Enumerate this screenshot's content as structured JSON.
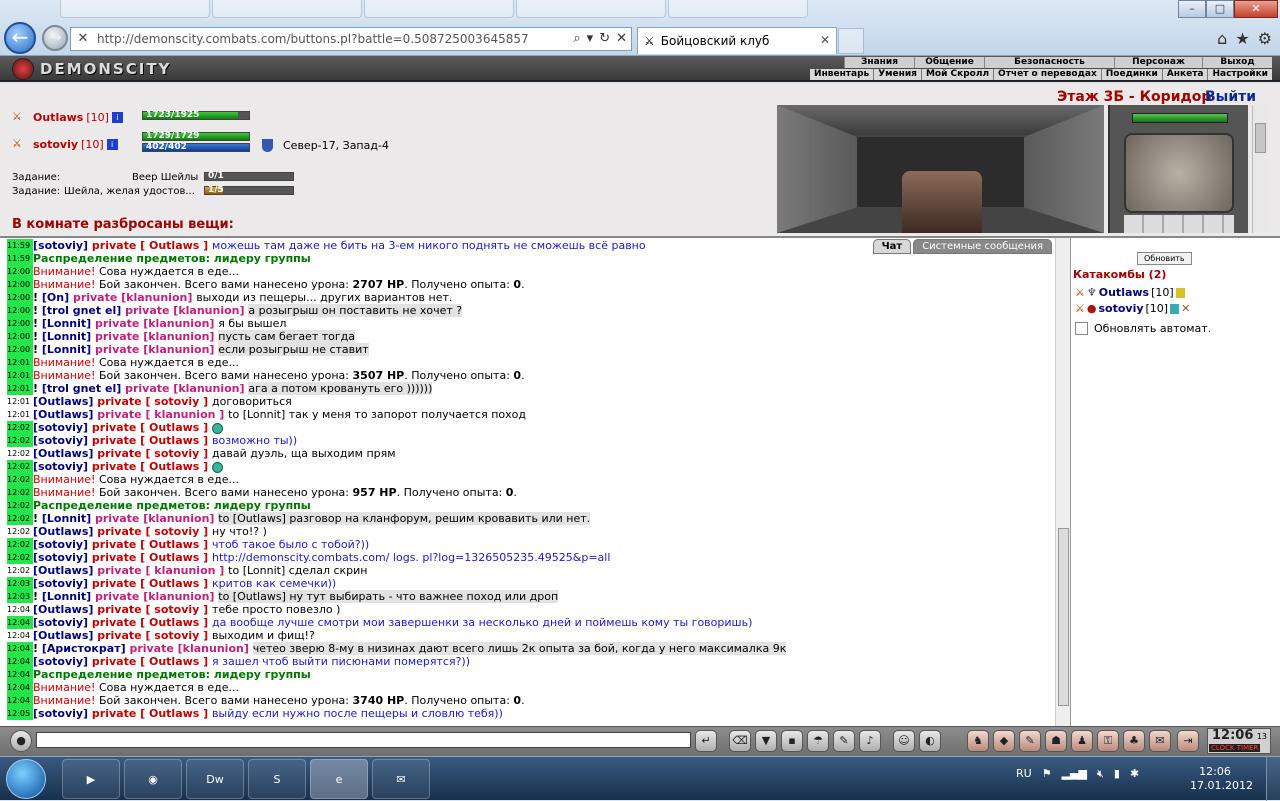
{
  "browser": {
    "url": "http://demonscity.combats.com/buttons.pl?battle=0.508725003645857",
    "tab_title": "Бойцовский клуб",
    "win_min": "–",
    "win_max": "□",
    "win_close": "✕",
    "back": "←",
    "fwd": "→"
  },
  "game": {
    "logo": "DEMONSCITY",
    "menu_top": [
      "Знания",
      "Общение",
      "Безопасность",
      "Персонаж",
      "Выход"
    ],
    "menu_bottom": [
      "Инвентарь",
      "Умения",
      "Мой Скролл",
      "Отчет о переводах",
      "Поединки",
      "Анкета",
      "Настройки"
    ]
  },
  "status": {
    "location": "Этаж 3Б - Коридор",
    "exit": "Выйти",
    "chars": [
      {
        "name": "Outlaws",
        "level": "[10]",
        "hp": "1723/1925",
        "hp_frac": 0.895
      },
      {
        "name": "sotoviy",
        "level": "[10]",
        "hp": "1729/1729",
        "hp_frac": 1.0,
        "mana": "402/402",
        "mana_frac": 1.0
      }
    ],
    "coord": "Север-17, Запад-4",
    "tasks": [
      {
        "label": "Задание:",
        "name": "Веер Шейлы",
        "progress": "0/1",
        "frac": 0.0
      },
      {
        "label": "Задание:",
        "name": "Шейла, желая удостов...",
        "progress": "1/5",
        "frac": 0.2
      }
    ],
    "items_header": "В комнате разбросаны вещи:"
  },
  "chat": {
    "tab_chat": "Чат",
    "tab_system": "Системные сообщения",
    "messages": [
      {
        "ts": "11:59",
        "hl": true,
        "parts": [
          [
            "nick",
            "[sotoviy]"
          ],
          [
            "priv",
            " private [ Outlaws ] "
          ],
          [
            "blue",
            "можешь там даже не бить на 3-ем никого поднять не сможешь всё равно"
          ]
        ]
      },
      {
        "ts": "11:59",
        "hl": true,
        "parts": [
          [
            "dist",
            "Распределение предметов: лидеру группы"
          ]
        ]
      },
      {
        "ts": "12:00",
        "hl": true,
        "parts": [
          [
            "warn",
            "Внимание! "
          ],
          [
            "tx",
            "Сова нуждается в еде..."
          ]
        ]
      },
      {
        "ts": "12:00",
        "hl": true,
        "parts": [
          [
            "warn",
            "Внимание! "
          ],
          [
            "tx",
            "Бой закончен. Всего вами нанесено урона: "
          ],
          [
            "ex",
            "2707 HP"
          ],
          [
            "tx",
            ". Получено опыта: "
          ],
          [
            "ex",
            "0"
          ],
          [
            "tx",
            "."
          ]
        ]
      },
      {
        "ts": "12:00",
        "hl": true,
        "parts": [
          [
            "ex",
            "! "
          ],
          [
            "nick",
            "[On]"
          ],
          [
            "priv2",
            " private [klanunion] "
          ],
          [
            "tx",
            "выходи из пещеры... других вариантов нет."
          ]
        ]
      },
      {
        "ts": "12:00",
        "hl": true,
        "parts": [
          [
            "ex",
            "! "
          ],
          [
            "nick",
            "[trol gnet el]"
          ],
          [
            "priv2",
            " private [klanunion] "
          ],
          [
            "hl",
            "а розыгрыш он поставить не хочет ?"
          ]
        ]
      },
      {
        "ts": "12:00",
        "hl": true,
        "parts": [
          [
            "ex",
            "! "
          ],
          [
            "nick",
            "[Lonnit]"
          ],
          [
            "priv2",
            " private [klanunion] "
          ],
          [
            "tx",
            "я бы вышел"
          ]
        ]
      },
      {
        "ts": "12:00",
        "hl": true,
        "parts": [
          [
            "ex",
            "! "
          ],
          [
            "nick",
            "[Lonnit]"
          ],
          [
            "priv2",
            " private [klanunion] "
          ],
          [
            "hl",
            "пусть сам бегает тогда"
          ]
        ]
      },
      {
        "ts": "12:00",
        "hl": true,
        "parts": [
          [
            "ex",
            "! "
          ],
          [
            "nick",
            "[Lonnit]"
          ],
          [
            "priv2",
            " private [klanunion] "
          ],
          [
            "hl",
            "если розыгрыш не ставит"
          ]
        ]
      },
      {
        "ts": "12:01",
        "hl": true,
        "parts": [
          [
            "warn",
            "Внимание! "
          ],
          [
            "tx",
            "Сова нуждается в еде..."
          ]
        ]
      },
      {
        "ts": "12:01",
        "hl": true,
        "parts": [
          [
            "warn",
            "Внимание! "
          ],
          [
            "tx",
            "Бой закончен. Всего вами нанесено урона: "
          ],
          [
            "ex",
            "3507 HP"
          ],
          [
            "tx",
            ". Получено опыта: "
          ],
          [
            "ex",
            "0"
          ],
          [
            "tx",
            "."
          ]
        ]
      },
      {
        "ts": "12:01",
        "hl": true,
        "parts": [
          [
            "ex",
            "! "
          ],
          [
            "nick",
            "[trol gnet el]"
          ],
          [
            "priv2",
            " private [klanunion] "
          ],
          [
            "hl",
            "ага а потом кровануть его ))))))"
          ]
        ]
      },
      {
        "ts": "12:01",
        "hl": false,
        "parts": [
          [
            "nick",
            "[Outlaws]"
          ],
          [
            "priv",
            " private [ sotoviy ] "
          ],
          [
            "tx",
            "договориться"
          ]
        ]
      },
      {
        "ts": "12:01",
        "hl": false,
        "parts": [
          [
            "nick",
            "[Outlaws]"
          ],
          [
            "priv2",
            " private [ klanunion ] "
          ],
          [
            "tx",
            "to [Lonnit] так у меня то запорот получается поход"
          ]
        ]
      },
      {
        "ts": "12:02",
        "hl": true,
        "smile": true,
        "parts": [
          [
            "nick",
            "[sotoviy]"
          ],
          [
            "priv",
            " private [ Outlaws ] "
          ]
        ]
      },
      {
        "ts": "12:02",
        "hl": true,
        "parts": [
          [
            "nick",
            "[sotoviy]"
          ],
          [
            "priv",
            " private [ Outlaws ] "
          ],
          [
            "blue",
            "возможно ты))"
          ]
        ]
      },
      {
        "ts": "12:02",
        "hl": false,
        "parts": [
          [
            "nick",
            "[Outlaws]"
          ],
          [
            "priv",
            " private [ sotoviy ] "
          ],
          [
            "tx",
            "давай дуэль, ща выходим прям"
          ]
        ]
      },
      {
        "ts": "12:02",
        "hl": true,
        "smile": true,
        "parts": [
          [
            "nick",
            "[sotoviy]"
          ],
          [
            "priv",
            " private [ Outlaws ] "
          ]
        ]
      },
      {
        "ts": "12:02",
        "hl": true,
        "parts": [
          [
            "warn",
            "Внимание! "
          ],
          [
            "tx",
            "Сова нуждается в еде..."
          ]
        ]
      },
      {
        "ts": "12:02",
        "hl": true,
        "parts": [
          [
            "warn",
            "Внимание! "
          ],
          [
            "tx",
            "Бой закончен. Всего вами нанесено урона: "
          ],
          [
            "ex",
            "957 HP"
          ],
          [
            "tx",
            ". Получено опыта: "
          ],
          [
            "ex",
            "0"
          ],
          [
            "tx",
            "."
          ]
        ]
      },
      {
        "ts": "12:02",
        "hl": true,
        "parts": [
          [
            "dist",
            "Распределение предметов: лидеру группы"
          ]
        ]
      },
      {
        "ts": "12:02",
        "hl": true,
        "parts": [
          [
            "ex",
            "! "
          ],
          [
            "nick",
            "[Lonnit]"
          ],
          [
            "priv2",
            " private [klanunion] "
          ],
          [
            "hl",
            "to [Outlaws] разговор на кланфорум, решим кровавить или нет."
          ]
        ]
      },
      {
        "ts": "12:02",
        "hl": false,
        "parts": [
          [
            "nick",
            "[Outlaws]"
          ],
          [
            "priv",
            " private [ sotoviy ] "
          ],
          [
            "tx",
            "ну что!? )"
          ]
        ]
      },
      {
        "ts": "12:02",
        "hl": true,
        "parts": [
          [
            "nick",
            "[sotoviy]"
          ],
          [
            "priv",
            " private [ Outlaws ] "
          ],
          [
            "blue",
            "чтоб такое было с тобой?))"
          ]
        ]
      },
      {
        "ts": "12:02",
        "hl": true,
        "parts": [
          [
            "nick",
            "[sotoviy]"
          ],
          [
            "priv",
            " private [ Outlaws ] "
          ],
          [
            "blue",
            "http://demonscity.combats.com/ logs. pl?log=1326505235.49525&p=all"
          ]
        ]
      },
      {
        "ts": "12:02",
        "hl": false,
        "parts": [
          [
            "nick",
            "[Outlaws]"
          ],
          [
            "priv2",
            " private [ klanunion ] "
          ],
          [
            "tx",
            "to [Lonnit] сделал скрин"
          ]
        ]
      },
      {
        "ts": "12:03",
        "hl": true,
        "parts": [
          [
            "nick",
            "[sotoviy]"
          ],
          [
            "priv",
            " private [ Outlaws ] "
          ],
          [
            "blue",
            "критов как семечки))"
          ]
        ]
      },
      {
        "ts": "12:03",
        "hl": true,
        "parts": [
          [
            "ex",
            "! "
          ],
          [
            "nick",
            "[Lonnit]"
          ],
          [
            "priv2",
            " private [klanunion] "
          ],
          [
            "hl",
            "to [Outlaws] ну тут выбирать - что важнее поход или дроп"
          ]
        ]
      },
      {
        "ts": "12:04",
        "hl": false,
        "parts": [
          [
            "nick",
            "[Outlaws]"
          ],
          [
            "priv",
            " private [ sotoviy ] "
          ],
          [
            "tx",
            "тебе просто повезло )"
          ]
        ]
      },
      {
        "ts": "12:04",
        "hl": true,
        "parts": [
          [
            "nick",
            "[sotoviy]"
          ],
          [
            "priv",
            " private [ Outlaws ] "
          ],
          [
            "blue",
            "да вообще лучше смотри мои завершенки за несколько дней и поймешь кому ты говоришь)"
          ]
        ]
      },
      {
        "ts": "12:04",
        "hl": false,
        "parts": [
          [
            "nick",
            "[Outlaws]"
          ],
          [
            "priv",
            " private [ sotoviy ] "
          ],
          [
            "tx",
            "выходим и фищ!?"
          ]
        ]
      },
      {
        "ts": "12:04",
        "hl": true,
        "parts": [
          [
            "ex",
            "! "
          ],
          [
            "nick",
            "[Аристократ]"
          ],
          [
            "priv2",
            " private [klanunion] "
          ],
          [
            "hl",
            "четео зверю 8-му в низинах дают всего лишь 2к опыта за бой, когда у него максималка 9к"
          ]
        ]
      },
      {
        "ts": "12:04",
        "hl": true,
        "parts": [
          [
            "nick",
            "[sotoviy]"
          ],
          [
            "priv",
            " private [ Outlaws ] "
          ],
          [
            "blue",
            "я зашел чтоб выйти писюнами померятся?))"
          ]
        ]
      },
      {
        "ts": "12:04",
        "hl": true,
        "parts": [
          [
            "dist",
            "Распределение предметов: лидеру группы"
          ]
        ]
      },
      {
        "ts": "12:04",
        "hl": true,
        "parts": [
          [
            "warn",
            "Внимание! "
          ],
          [
            "tx",
            "Сова нуждается в еде..."
          ]
        ]
      },
      {
        "ts": "12:04",
        "hl": true,
        "parts": [
          [
            "warn",
            "Внимание! "
          ],
          [
            "tx",
            "Бой закончен. Всего вами нанесено урона: "
          ],
          [
            "ex",
            "3740 HP"
          ],
          [
            "tx",
            ". Получено опыта: "
          ],
          [
            "ex",
            "0"
          ],
          [
            "tx",
            "."
          ]
        ]
      },
      {
        "ts": "12:05",
        "hl": true,
        "parts": [
          [
            "nick",
            "[sotoviy]"
          ],
          [
            "priv",
            " private [ Outlaws ] "
          ],
          [
            "blue",
            "выйду если нужно после пещеры и словлю тебя))"
          ]
        ]
      }
    ]
  },
  "room": {
    "refresh": "Обновить",
    "title": "Катакомбы (2)",
    "members": [
      {
        "name": "Outlaws",
        "level": "[10]"
      },
      {
        "name": "sotoviy",
        "level": "[10]"
      }
    ],
    "auto_refresh": "Обновлять автомат."
  },
  "bottom": {
    "clock": "12:06",
    "clock_sec": "13",
    "clock_label": "CLOCK TIMER"
  },
  "taskbar": {
    "lang": "RU",
    "time": "12:06",
    "date": "17.01.2012",
    "apps": [
      "▶",
      "◉",
      "Dw",
      "S",
      "e",
      "✉"
    ]
  }
}
